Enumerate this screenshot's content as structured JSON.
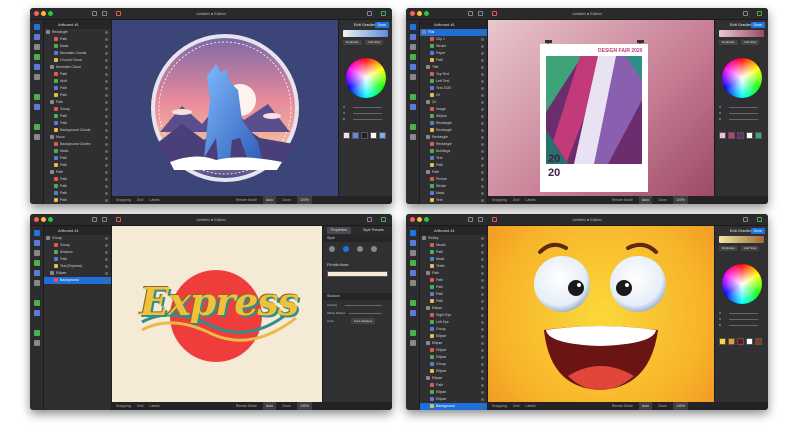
{
  "win1": {
    "title": "Untitled ● Edited",
    "artboard": "Artboard #1",
    "layers": [
      "Rectangle",
      "Path",
      "Mask",
      "Mountain Clouds",
      "Ground Cloud",
      "Mountain Cloud",
      "Path",
      "Wolf",
      "Path",
      "Path",
      "Path",
      "Group",
      "Path",
      "Path",
      "Background Clouds",
      "Moon",
      "Background Circles",
      "Mask",
      "Path",
      "Path",
      "Path",
      "Path",
      "Path",
      "Path",
      "Path",
      "Path",
      "Ellipse",
      "Background"
    ],
    "status": {
      "snapping": "Snapping",
      "grid": "Grid",
      "labels": "Labels",
      "render": "Render Mode",
      "render_val": "Auto",
      "zoom": "Zoom",
      "zoom_val": "100%"
    },
    "inspector": {
      "heading": "Edit Gradient",
      "done": "Done",
      "b1": "Duplicate",
      "b2": "Add Stop",
      "b3": "Delete Stop"
    },
    "colors": {
      "bg": "#3b4577",
      "accent": "#1e74e0"
    }
  },
  "win2": {
    "title": "Untitled ● Edited",
    "artboard": "Artboard #1",
    "layers": [
      "Fills",
      "Clip 1",
      "Stroke",
      "Paper",
      "Path",
      "Title",
      "Top Text",
      "Left Text",
      "Text 2020",
      "20",
      "20",
      "Image",
      "Stripes",
      "Rectangle",
      "Rectangle",
      "Rectangle",
      "Rectangle",
      "Buildings",
      "Text",
      "Path",
      "Path",
      "Picture",
      "Stroke",
      "Mask",
      "Text",
      "Background",
      "Shadow"
    ],
    "poster": {
      "title": "DESIGN FAIR 2020",
      "num1": "20",
      "num2": "20"
    },
    "status": {
      "snapping": "Snapping",
      "grid": "Grid",
      "labels": "Labels",
      "render": "Render Mode",
      "render_val": "Auto",
      "zoom": "Zoom",
      "zoom_val": "100%"
    },
    "inspector": {
      "heading": "Edit Gradient",
      "done": "Done",
      "b1": "Duplicate",
      "b2": "Add Stop",
      "b3": "Delete Stop"
    }
  },
  "win3": {
    "title": "Untitled ● Edited",
    "artboard": "Artboard #1",
    "layers": [
      "Group",
      "Group",
      "Shadow",
      "Path",
      "Text (Express)",
      "Ellipse",
      "Background"
    ],
    "express_text": "Express",
    "status": {
      "snapping": "Snapping",
      "grid": "Grid",
      "labels": "Labels",
      "render": "Render Mode",
      "render_val": "Auto",
      "zoom": "Zoom",
      "zoom_val": "100%"
    },
    "inspector": {
      "tab1": "Properties",
      "tab2": "Style Presets",
      "style": "Style",
      "fill": "Fill with Noise",
      "shadow": "Shadow",
      "opacity": "Opacity",
      "offset": "Offset Radius",
      "color": "Color",
      "font_label": "Font Labeled"
    }
  },
  "win4": {
    "title": "Untitled ● Edited",
    "artboard": "Artboard #1",
    "layers": [
      "Smiley",
      "Mouth",
      "Path",
      "Mask",
      "Teeth",
      "Path",
      "Path",
      "Path",
      "Path",
      "Path",
      "Ellipse",
      "Right Eye",
      "Left Eye",
      "Group",
      "Ellipse",
      "Ellipse",
      "Ellipse",
      "Ellipse",
      "Group",
      "Ellipse",
      "Ellipse",
      "Path",
      "Ellipse",
      "Ellipse",
      "Background"
    ],
    "status": {
      "snapping": "Snapping",
      "grid": "Grid",
      "labels": "Labels",
      "render": "Render Mode",
      "render_val": "Auto",
      "zoom": "Zoom",
      "zoom_val": "100%"
    },
    "inspector": {
      "heading": "Edit Gradient",
      "done": "Done",
      "b1": "Duplicate",
      "b2": "Add Stop",
      "b3": "Delete Stop"
    }
  }
}
